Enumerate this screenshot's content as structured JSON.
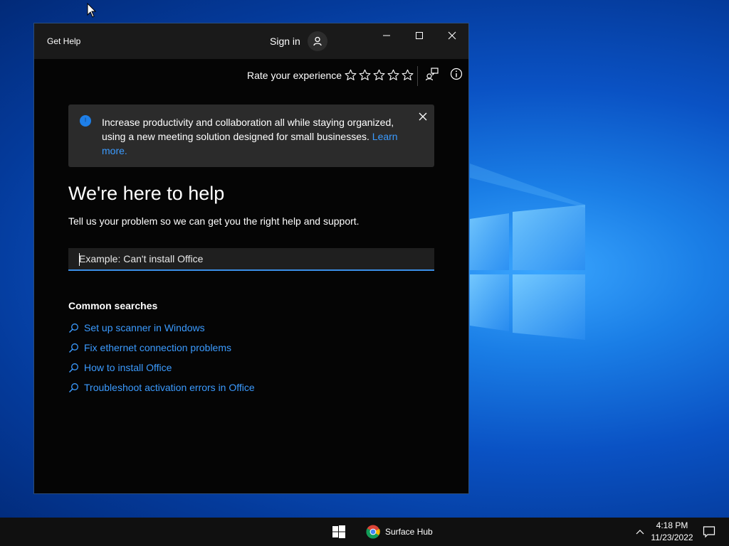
{
  "app": {
    "title": "Get Help",
    "sign_in_label": "Sign in",
    "rate_label": "Rate your experience",
    "star_count": 5
  },
  "banner": {
    "text": "Increase productivity and collaboration all while staying organized, using a new meeting solution designed for small businesses.",
    "link_text": "Learn more."
  },
  "main": {
    "heading": "We're here to help",
    "subheading": "Tell us your problem so we can get you the right help and support.",
    "search_placeholder": "Example: Can't install Office"
  },
  "common_searches": {
    "title": "Common searches",
    "items": [
      "Set up scanner in Windows",
      "Fix ethernet connection problems",
      "How to install Office",
      "Troubleshoot activation errors in Office"
    ]
  },
  "taskbar": {
    "pinned_app_label": "Surface Hub",
    "time": "4:18 PM",
    "date": "11/23/2022"
  },
  "colors": {
    "accent_link": "#3b9bff",
    "window_bg": "#050505",
    "banner_bg": "#2b2b2b",
    "taskbar_bg": "#101010"
  }
}
